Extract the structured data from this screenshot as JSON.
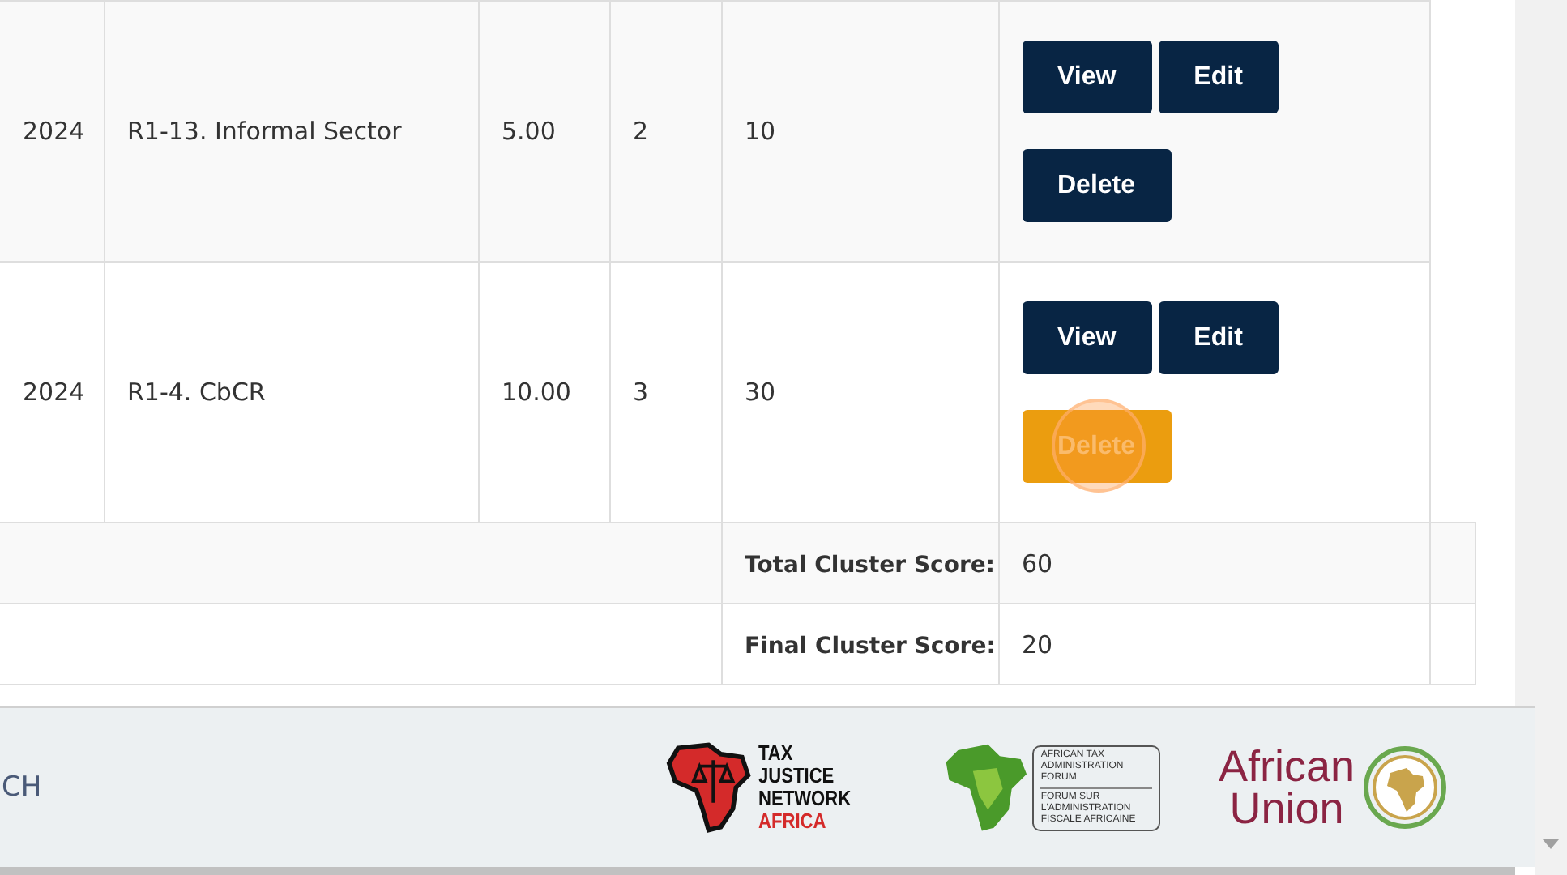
{
  "rows": [
    {
      "cells": [
        "2024",
        "R1-13. Informal Sector",
        "5.00",
        "2",
        "10"
      ],
      "actions": [
        {
          "label": "View",
          "highlighted": false
        },
        {
          "label": "Edit",
          "highlighted": false
        },
        {
          "label": "Delete",
          "highlighted": false
        }
      ]
    },
    {
      "cells": [
        "2024",
        "R1-4. CbCR",
        "10.00",
        "3",
        "30"
      ],
      "actions": [
        {
          "label": "View",
          "highlighted": false
        },
        {
          "label": "Edit",
          "highlighted": false
        },
        {
          "label": "Delete",
          "highlighted": true
        }
      ]
    }
  ],
  "summary": [
    {
      "label": "Total Cluster Score:",
      "value": "60"
    },
    {
      "label": "Final Cluster Score:",
      "value": "20"
    }
  ],
  "footer": {
    "left_text": "CH",
    "logos": [
      {
        "kind": "tjn",
        "lines": [
          "TAX JUSTICE",
          "NETWORK"
        ],
        "accent": "AFRICA"
      },
      {
        "kind": "ataf",
        "lines": [
          "AFRICAN TAX",
          "ADMINISTRATION FORUM"
        ],
        "lines_2": [
          "FORUM SUR",
          "L'ADMINISTRATION",
          "FISCALE AFRICAINE"
        ]
      },
      {
        "kind": "au",
        "lines": [
          "African",
          "Union"
        ]
      }
    ]
  }
}
